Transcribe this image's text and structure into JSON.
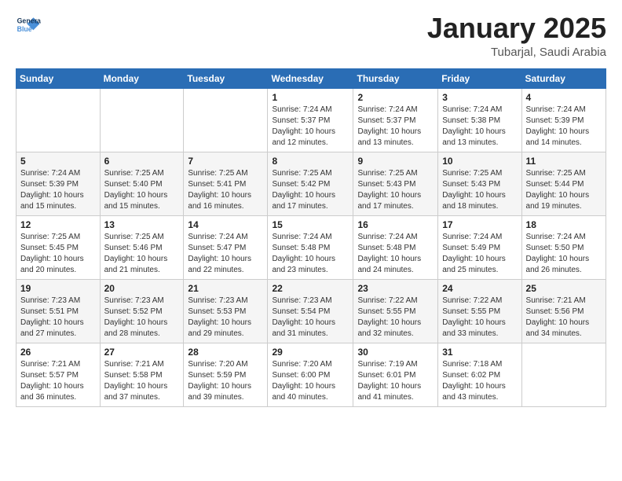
{
  "logo": {
    "line1": "General",
    "line2": "Blue"
  },
  "title": "January 2025",
  "subtitle": "Tubarjal, Saudi Arabia",
  "weekdays": [
    "Sunday",
    "Monday",
    "Tuesday",
    "Wednesday",
    "Thursday",
    "Friday",
    "Saturday"
  ],
  "weeks": [
    [
      {
        "day": "",
        "info": ""
      },
      {
        "day": "",
        "info": ""
      },
      {
        "day": "",
        "info": ""
      },
      {
        "day": "1",
        "info": "Sunrise: 7:24 AM\nSunset: 5:37 PM\nDaylight: 10 hours\nand 12 minutes."
      },
      {
        "day": "2",
        "info": "Sunrise: 7:24 AM\nSunset: 5:37 PM\nDaylight: 10 hours\nand 13 minutes."
      },
      {
        "day": "3",
        "info": "Sunrise: 7:24 AM\nSunset: 5:38 PM\nDaylight: 10 hours\nand 13 minutes."
      },
      {
        "day": "4",
        "info": "Sunrise: 7:24 AM\nSunset: 5:39 PM\nDaylight: 10 hours\nand 14 minutes."
      }
    ],
    [
      {
        "day": "5",
        "info": "Sunrise: 7:24 AM\nSunset: 5:39 PM\nDaylight: 10 hours\nand 15 minutes."
      },
      {
        "day": "6",
        "info": "Sunrise: 7:25 AM\nSunset: 5:40 PM\nDaylight: 10 hours\nand 15 minutes."
      },
      {
        "day": "7",
        "info": "Sunrise: 7:25 AM\nSunset: 5:41 PM\nDaylight: 10 hours\nand 16 minutes."
      },
      {
        "day": "8",
        "info": "Sunrise: 7:25 AM\nSunset: 5:42 PM\nDaylight: 10 hours\nand 17 minutes."
      },
      {
        "day": "9",
        "info": "Sunrise: 7:25 AM\nSunset: 5:43 PM\nDaylight: 10 hours\nand 17 minutes."
      },
      {
        "day": "10",
        "info": "Sunrise: 7:25 AM\nSunset: 5:43 PM\nDaylight: 10 hours\nand 18 minutes."
      },
      {
        "day": "11",
        "info": "Sunrise: 7:25 AM\nSunset: 5:44 PM\nDaylight: 10 hours\nand 19 minutes."
      }
    ],
    [
      {
        "day": "12",
        "info": "Sunrise: 7:25 AM\nSunset: 5:45 PM\nDaylight: 10 hours\nand 20 minutes."
      },
      {
        "day": "13",
        "info": "Sunrise: 7:25 AM\nSunset: 5:46 PM\nDaylight: 10 hours\nand 21 minutes."
      },
      {
        "day": "14",
        "info": "Sunrise: 7:24 AM\nSunset: 5:47 PM\nDaylight: 10 hours\nand 22 minutes."
      },
      {
        "day": "15",
        "info": "Sunrise: 7:24 AM\nSunset: 5:48 PM\nDaylight: 10 hours\nand 23 minutes."
      },
      {
        "day": "16",
        "info": "Sunrise: 7:24 AM\nSunset: 5:48 PM\nDaylight: 10 hours\nand 24 minutes."
      },
      {
        "day": "17",
        "info": "Sunrise: 7:24 AM\nSunset: 5:49 PM\nDaylight: 10 hours\nand 25 minutes."
      },
      {
        "day": "18",
        "info": "Sunrise: 7:24 AM\nSunset: 5:50 PM\nDaylight: 10 hours\nand 26 minutes."
      }
    ],
    [
      {
        "day": "19",
        "info": "Sunrise: 7:23 AM\nSunset: 5:51 PM\nDaylight: 10 hours\nand 27 minutes."
      },
      {
        "day": "20",
        "info": "Sunrise: 7:23 AM\nSunset: 5:52 PM\nDaylight: 10 hours\nand 28 minutes."
      },
      {
        "day": "21",
        "info": "Sunrise: 7:23 AM\nSunset: 5:53 PM\nDaylight: 10 hours\nand 29 minutes."
      },
      {
        "day": "22",
        "info": "Sunrise: 7:23 AM\nSunset: 5:54 PM\nDaylight: 10 hours\nand 31 minutes."
      },
      {
        "day": "23",
        "info": "Sunrise: 7:22 AM\nSunset: 5:55 PM\nDaylight: 10 hours\nand 32 minutes."
      },
      {
        "day": "24",
        "info": "Sunrise: 7:22 AM\nSunset: 5:55 PM\nDaylight: 10 hours\nand 33 minutes."
      },
      {
        "day": "25",
        "info": "Sunrise: 7:21 AM\nSunset: 5:56 PM\nDaylight: 10 hours\nand 34 minutes."
      }
    ],
    [
      {
        "day": "26",
        "info": "Sunrise: 7:21 AM\nSunset: 5:57 PM\nDaylight: 10 hours\nand 36 minutes."
      },
      {
        "day": "27",
        "info": "Sunrise: 7:21 AM\nSunset: 5:58 PM\nDaylight: 10 hours\nand 37 minutes."
      },
      {
        "day": "28",
        "info": "Sunrise: 7:20 AM\nSunset: 5:59 PM\nDaylight: 10 hours\nand 39 minutes."
      },
      {
        "day": "29",
        "info": "Sunrise: 7:20 AM\nSunset: 6:00 PM\nDaylight: 10 hours\nand 40 minutes."
      },
      {
        "day": "30",
        "info": "Sunrise: 7:19 AM\nSunset: 6:01 PM\nDaylight: 10 hours\nand 41 minutes."
      },
      {
        "day": "31",
        "info": "Sunrise: 7:18 AM\nSunset: 6:02 PM\nDaylight: 10 hours\nand 43 minutes."
      },
      {
        "day": "",
        "info": ""
      }
    ]
  ]
}
